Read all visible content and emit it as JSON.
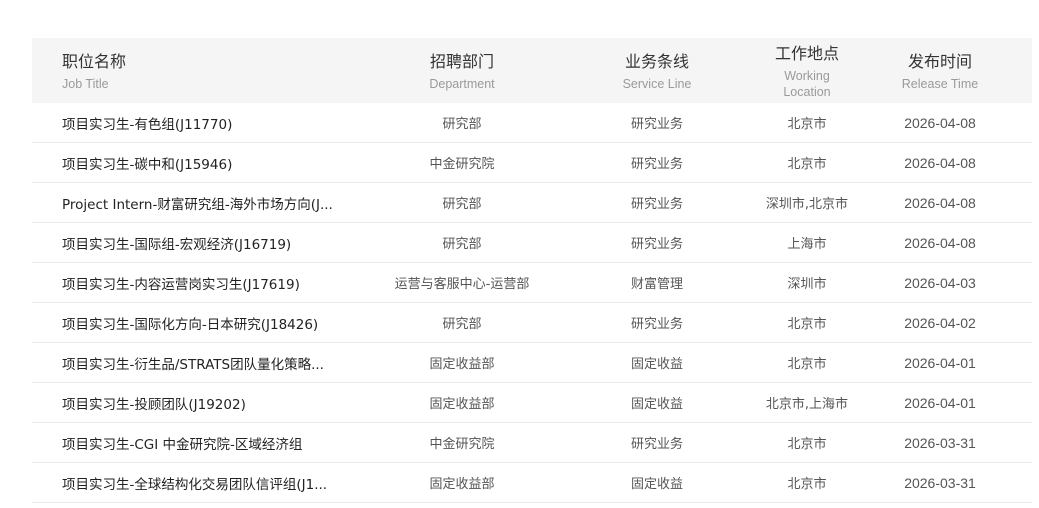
{
  "header": {
    "title": {
      "zh": "职位名称",
      "en": "Job Title"
    },
    "department": {
      "zh": "招聘部门",
      "en": "Department"
    },
    "service_line": {
      "zh": "业务条线",
      "en": "Service Line"
    },
    "location": {
      "zh": "工作地点",
      "en": "Working Location"
    },
    "release_time": {
      "zh": "发布时间",
      "en": "Release Time"
    }
  },
  "rows": [
    {
      "title": "项目实习生-有色组(J11770)",
      "department": "研究部",
      "service_line": "研究业务",
      "location": "北京市",
      "release_time": "2026-04-08"
    },
    {
      "title": "项目实习生-碳中和(J15946)",
      "department": "中金研究院",
      "service_line": "研究业务",
      "location": "北京市",
      "release_time": "2026-04-08"
    },
    {
      "title": "Project Intern-财富研究组-海外市场方向(J...",
      "department": "研究部",
      "service_line": "研究业务",
      "location": "深圳市,北京市",
      "release_time": "2026-04-08"
    },
    {
      "title": "项目实习生-国际组-宏观经济(J16719)",
      "department": "研究部",
      "service_line": "研究业务",
      "location": "上海市",
      "release_time": "2026-04-08"
    },
    {
      "title": "项目实习生-内容运营岗实习生(J17619)",
      "department": "运营与客服中心-运营部",
      "service_line": "财富管理",
      "location": "深圳市",
      "release_time": "2026-04-03"
    },
    {
      "title": "项目实习生-国际化方向-日本研究(J18426)",
      "department": "研究部",
      "service_line": "研究业务",
      "location": "北京市",
      "release_time": "2026-04-02"
    },
    {
      "title": "项目实习生-衍生品/STRATS团队量化策略...",
      "department": "固定收益部",
      "service_line": "固定收益",
      "location": "北京市",
      "release_time": "2026-04-01"
    },
    {
      "title": "项目实习生-投顾团队(J19202)",
      "department": "固定收益部",
      "service_line": "固定收益",
      "location": "北京市,上海市",
      "release_time": "2026-04-01"
    },
    {
      "title": "项目实习生-CGI 中金研究院-区域经济组",
      "department": "中金研究院",
      "service_line": "研究业务",
      "location": "北京市",
      "release_time": "2026-03-31"
    },
    {
      "title": "项目实习生-全球结构化交易团队信评组(J1...",
      "department": "固定收益部",
      "service_line": "固定收益",
      "location": "北京市",
      "release_time": "2026-03-31"
    }
  ]
}
